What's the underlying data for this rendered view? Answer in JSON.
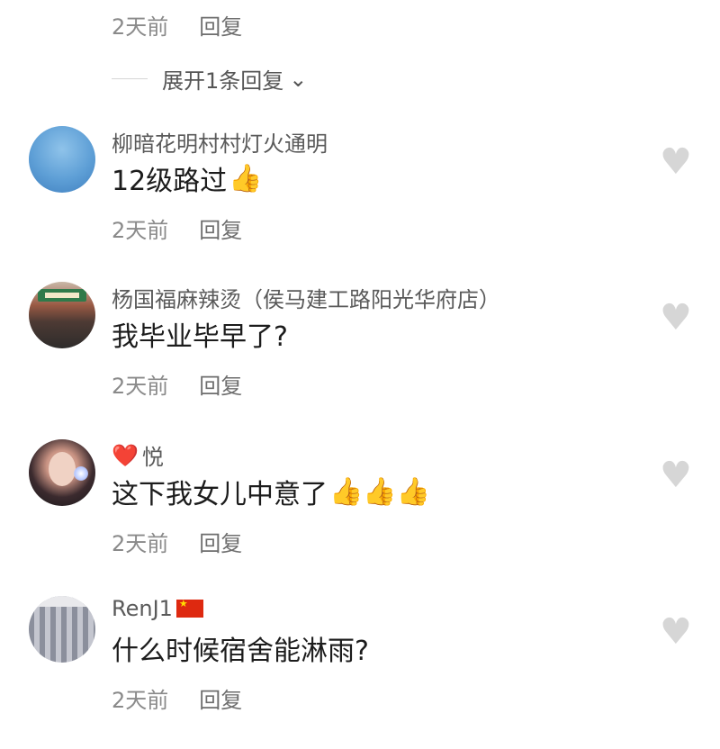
{
  "top_meta": {
    "time": "2天前",
    "reply": "回复"
  },
  "expand": {
    "label": "展开1条回复",
    "chevron": "chevron-down-icon"
  },
  "comments": [
    {
      "name": "柳暗花明村村灯火通明",
      "text": "12级路过",
      "thumbs": "👍",
      "time": "2天前",
      "reply": "回复"
    },
    {
      "name": "杨国福麻辣烫（侯马建工路阳光华府店）",
      "text": "我毕业毕早了?",
      "time": "2天前",
      "reply": "回复"
    },
    {
      "name_prefix": "❤️",
      "name": "悦",
      "text": "这下我女儿中意了",
      "thumbs": "👍👍👍",
      "time": "2天前",
      "reply": "回复"
    },
    {
      "name": "RenJ1",
      "flag": "china-flag-icon",
      "text": "什么时候宿舍能淋雨?",
      "time": "2天前",
      "reply": "回复"
    }
  ],
  "icons": {
    "like": "heart-icon",
    "like_color": "#d6d6d6"
  }
}
